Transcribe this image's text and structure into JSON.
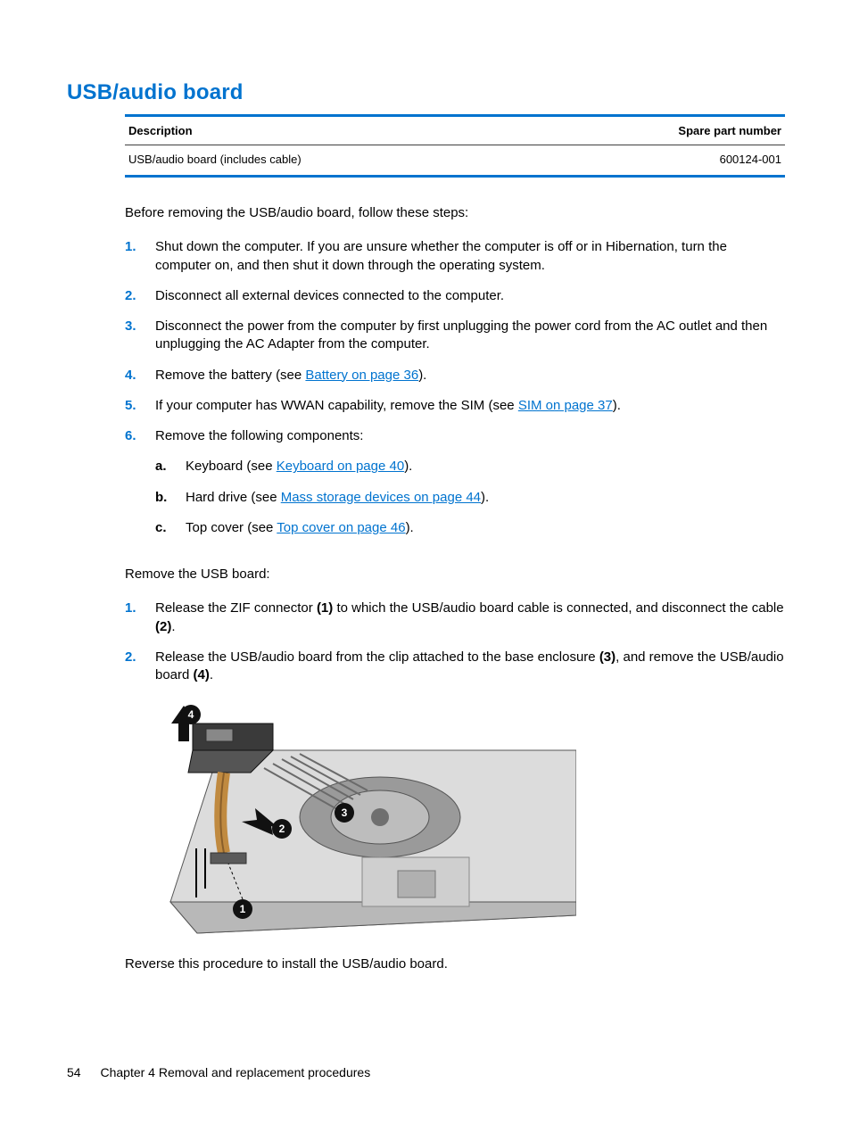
{
  "title": "USB/audio board",
  "table": {
    "header_desc": "Description",
    "header_part": "Spare part number",
    "row_desc": "USB/audio board (includes cable)",
    "row_part": "600124-001"
  },
  "intro": "Before removing the USB/audio board, follow these steps:",
  "steps1": {
    "m1": "1.",
    "t1": "Shut down the computer. If you are unsure whether the computer is off or in Hibernation, turn the computer on, and then shut it down through the operating system.",
    "m2": "2.",
    "t2": "Disconnect all external devices connected to the computer.",
    "m3": "3.",
    "t3": "Disconnect the power from the computer by first unplugging the power cord from the AC outlet and then unplugging the AC Adapter from the computer.",
    "m4": "4.",
    "t4_a": "Remove the battery (see ",
    "t4_link": "Battery on page 36",
    "t4_b": ").",
    "m5": "5.",
    "t5_a": "If your computer has WWAN capability, remove the SIM (see ",
    "t5_link": "SIM on page 37",
    "t5_b": ").",
    "m6": "6.",
    "t6": "Remove the following components:"
  },
  "sub": {
    "ma": "a.",
    "ta_a": "Keyboard (see ",
    "ta_link": "Keyboard on page 40",
    "ta_b": ").",
    "mb": "b.",
    "tb_a": "Hard drive (see ",
    "tb_link": "Mass storage devices on page 44",
    "tb_b": ").",
    "mc": "c.",
    "tc_a": "Top cover (see ",
    "tc_link": "Top cover on page 46",
    "tc_b": ")."
  },
  "intro2": "Remove the USB board:",
  "steps2": {
    "m1": "1.",
    "t1_a": "Release the ZIF connector ",
    "t1_b1": "(1)",
    "t1_c": " to which the USB/audio board cable is connected, and disconnect the cable ",
    "t1_b2": "(2)",
    "t1_d": ".",
    "m2": "2.",
    "t2_a": "Release the USB/audio board from the clip attached to the base enclosure ",
    "t2_b1": "(3)",
    "t2_c": ", and remove the USB/audio board ",
    "t2_b2": "(4)",
    "t2_d": "."
  },
  "fig": {
    "c1": "1",
    "c2": "2",
    "c3": "3",
    "c4": "4"
  },
  "closing": "Reverse this procedure to install the USB/audio board.",
  "footer": {
    "pageno": "54",
    "chapter": "Chapter 4   Removal and replacement procedures"
  }
}
